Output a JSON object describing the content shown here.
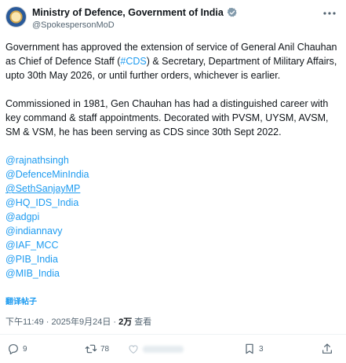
{
  "tweet": {
    "display_name": "Ministry of Defence, Government of India",
    "handle": "@SpokespersonMoD",
    "para1_a": "Government has approved the extension of service of General Anil Chauhan as Chief of Defence Staff (",
    "hashtag": "#CDS",
    "para1_b": ") & Secretary, Department of Military Affairs, upto 30th May 2026, or until further orders, whichever is earlier.",
    "para2": "Commissioned in 1981, Gen Chauhan has had a distinguished career with key command & staff appointments. Decorated with PVSM, UYSM, AVSM, SM & VSM, he has been serving as CDS since 30th Sept 2022.",
    "mentions": [
      "@rajnathsingh",
      "@DefenceMinIndia",
      "@SethSanjayMP",
      "@HQ_IDS_India",
      "@adgpi",
      "@indiannavy",
      "@IAF_MCC",
      "@PIB_India",
      "@MIB_India"
    ],
    "translate_label": "翻译帖子",
    "time": "下午11:49",
    "separator": " · ",
    "date": "2025年9月24日",
    "views_count": "2万",
    "views_label": " 查看"
  },
  "actions": {
    "replies": "9",
    "reposts": "78",
    "bookmarks": "3"
  },
  "colors": {
    "link": "#1d9bf0",
    "text": "#0f1419",
    "muted": "#536471",
    "verified": "#829aab"
  },
  "icons": [
    "more-icon",
    "verified-badge-icon",
    "reply-icon",
    "repost-icon",
    "like-icon",
    "bookmark-icon",
    "share-icon"
  ]
}
